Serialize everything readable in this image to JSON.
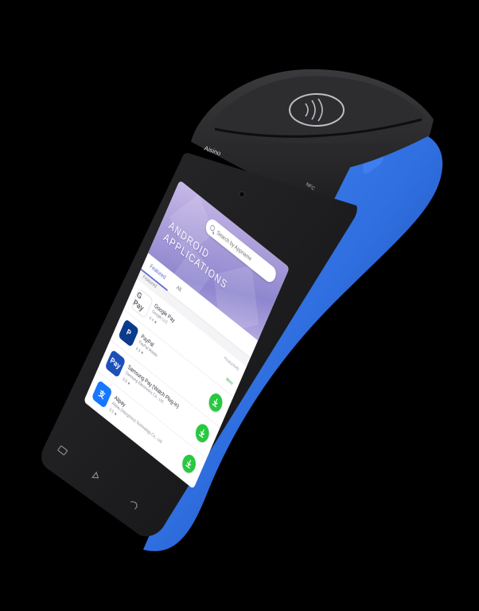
{
  "device": {
    "brand_mark": "Aisino",
    "nfc_label": "NFC",
    "colors": {
      "body_blue": "#2f6fe0",
      "body_blue_dark": "#1c3f9a",
      "printer_black": "#262628",
      "bezel": "#1a1a1c"
    }
  },
  "screen": {
    "search_placeholder": "Search by Appname",
    "title_line1": "ANDROID",
    "title_line2": "APPLICATIONS",
    "tabs": [
      "Featured",
      "All"
    ],
    "section_label": "Featured",
    "apps": [
      {
        "name": "Google Pay",
        "developer": "Google LLC",
        "rating": "4.4 ★",
        "icon": "google-pay-icon",
        "icon_text": "G Pay",
        "icon_bg": "#ffffff",
        "icon_fg": "#5f6368",
        "side_text": "Productivity",
        "more": "More",
        "download": false
      },
      {
        "name": "PayPal",
        "developer": "PayPal Mobile",
        "rating": "4.3 ★",
        "icon": "paypal-icon",
        "icon_text": "P",
        "icon_bg": "#0a3b8c",
        "icon_fg": "#ffffff",
        "download": true
      },
      {
        "name": "Samsung Pay (Watch Plug-in)",
        "developer": "Samsung Electronics Co., Ltd.",
        "rating": "3.9 ★",
        "icon": "samsung-pay-icon",
        "icon_text": "Pay",
        "icon_bg": "#1c4fb8",
        "icon_fg": "#ffffff",
        "download": true
      },
      {
        "name": "Alipay",
        "developer": "Alipay (Hangzhou) Technology Co., Ltd.",
        "rating": "3.5 ★",
        "icon": "alipay-icon",
        "icon_text": "支",
        "icon_bg": "#1677ff",
        "icon_fg": "#ffffff",
        "download": true
      },
      {
        "name": "",
        "developer": "",
        "rating": "",
        "icon": "app-icon",
        "icon_text": "",
        "icon_bg": "#f4f4f6",
        "icon_fg": "#ffffff",
        "download": true
      }
    ],
    "accent": "#5a6bd0",
    "download_green": "#27c93f"
  }
}
